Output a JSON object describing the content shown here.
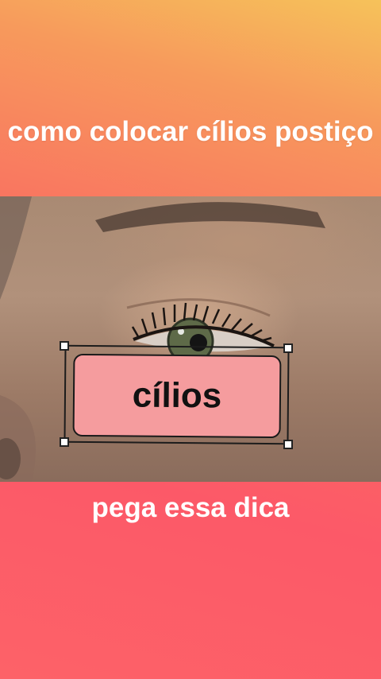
{
  "video": {
    "title": "como colocar cílios postiço",
    "caption": "pega essa dica"
  },
  "sticker": {
    "label": "cílios"
  },
  "colors": {
    "sticker_fill": "#f59c9e",
    "text": "#ffffff",
    "selection_handle": "#ffffff"
  }
}
